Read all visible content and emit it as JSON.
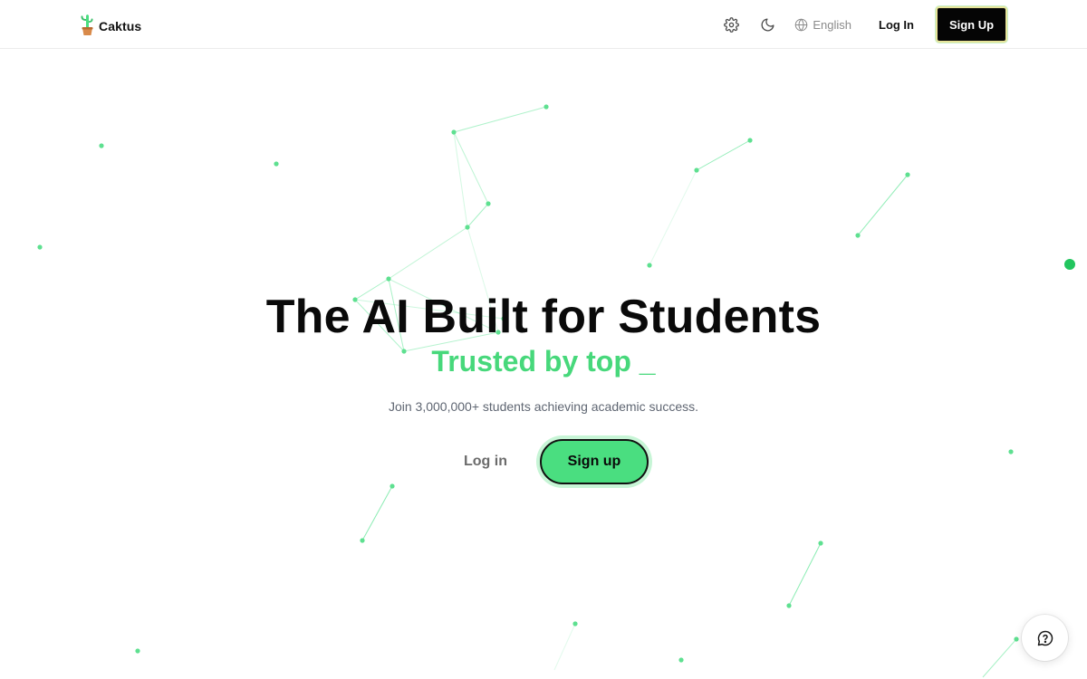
{
  "brand": {
    "name": "Caktus",
    "logo_icon": "cactus-logo-icon"
  },
  "header": {
    "settings_icon": "gear-icon",
    "theme_icon": "moon-icon",
    "language": {
      "icon": "globe-icon",
      "selected": "English"
    },
    "login_label": "Log In",
    "signup_label": "Sign Up"
  },
  "hero": {
    "title": "The AI Built for Students",
    "subtitle": "Trusted by top _",
    "description": "Join 3,000,000+ students achieving academic success.",
    "login_label": "Log in",
    "signup_label": "Sign up"
  },
  "help_widget": {
    "icon": "help-chat-icon"
  },
  "colors": {
    "accent": "#4ade80",
    "accent_text": "#47d87b",
    "dark": "#050505",
    "muted_text": "#5f6672"
  }
}
